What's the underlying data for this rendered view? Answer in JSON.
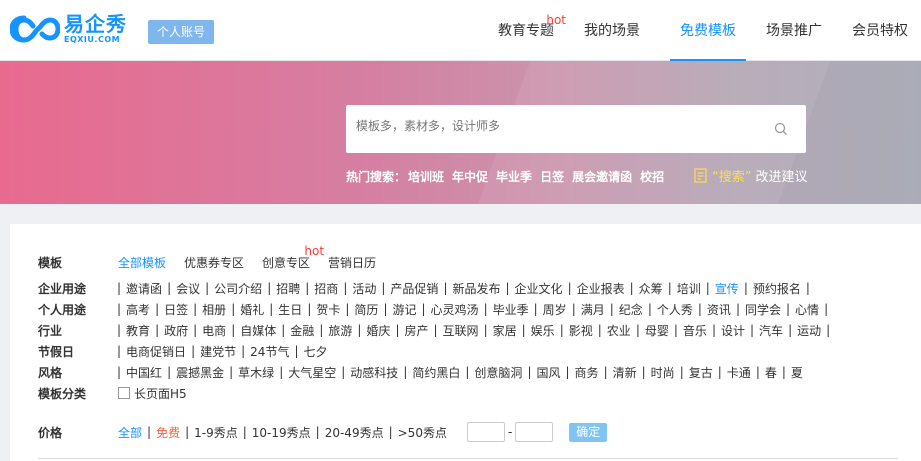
{
  "logo": {
    "cn": "易企秀",
    "en": "EQXIU.COM"
  },
  "account_button": "个人账号",
  "nav": [
    {
      "label": "教育专题",
      "hot": "hot"
    },
    {
      "label": "我的场景"
    },
    {
      "label": "免费模板",
      "active": true
    },
    {
      "label": "场景推广"
    },
    {
      "label": "会员特权"
    }
  ],
  "search": {
    "placeholder": "模板多，素材多，设计师多"
  },
  "hot_search": {
    "label": "热门搜索：",
    "terms": [
      "培训班",
      "年中促",
      "毕业季",
      "日签",
      "展会邀请函",
      "校招"
    ]
  },
  "suggest": {
    "quoted": "“搜索”",
    "text": "改进建议"
  },
  "filters": {
    "template": {
      "label": "模板",
      "tabs": [
        "全部模板",
        "优惠券专区",
        "创意专区",
        "营销日历"
      ],
      "hot": "hot"
    },
    "rows": [
      {
        "label": "企业用途",
        "items": [
          "邀请函",
          "会议",
          "公司介绍",
          "招聘",
          "招商",
          "活动",
          "产品促销",
          "新品发布",
          "企业文化",
          "企业报表",
          "众筹",
          "培训",
          "宣传",
          "预约报名"
        ]
      },
      {
        "label": "个人用途",
        "items": [
          "高考",
          "日签",
          "相册",
          "婚礼",
          "生日",
          "贺卡",
          "简历",
          "游记",
          "心灵鸡汤",
          "毕业季",
          "周岁",
          "满月",
          "纪念",
          "个人秀",
          "资讯",
          "同学会",
          "心情"
        ]
      },
      {
        "label": "行业",
        "items": [
          "教育",
          "政府",
          "电商",
          "自媒体",
          "金融",
          "旅游",
          "婚庆",
          "房产",
          "互联网",
          "家居",
          "娱乐",
          "影视",
          "农业",
          "母婴",
          "音乐",
          "设计",
          "汽车",
          "运动"
        ]
      },
      {
        "label": "节假日",
        "items": [
          "电商促销日",
          "建党节",
          "24节气",
          "七夕"
        ]
      },
      {
        "label": "风格",
        "items": [
          "中国红",
          "震撼黑金",
          "草木绿",
          "大气星空",
          "动感科技",
          "简约黑白",
          "创意脑洞",
          "国风",
          "商务",
          "清新",
          "时尚",
          "复古",
          "卡通",
          "春",
          "夏"
        ]
      }
    ],
    "category": {
      "label": "模板分类",
      "option": "长页面H5"
    },
    "price": {
      "label": "价格",
      "options": [
        "全部",
        "免费",
        "1-9秀点",
        "10-19秀点",
        "20-49秀点",
        ">50秀点"
      ],
      "dash": "-",
      "confirm": "确定"
    }
  },
  "colors": {
    "accent": "#1593ff",
    "hot": "#ff3b30"
  }
}
